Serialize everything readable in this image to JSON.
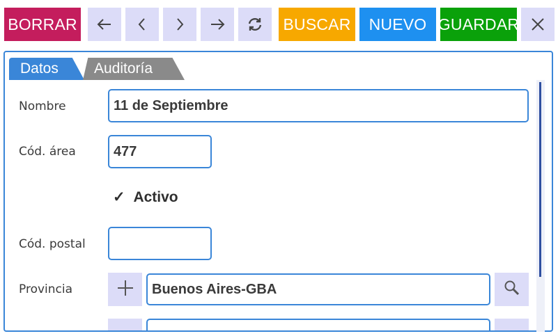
{
  "toolbar": {
    "borrar": "BORRAR",
    "buscar": "BUSCAR",
    "nuevo": "NUEVO",
    "guardar": "GUARDAR",
    "colors": {
      "borrar": "#c41d5d",
      "buscar": "#f7a800",
      "nuevo": "#1e90f0",
      "guardar": "#0aa10a",
      "nav": "#dcdcf8"
    },
    "icons": [
      "arrow-left-icon",
      "chevron-left-icon",
      "chevron-right-icon",
      "arrow-right-icon",
      "refresh-icon",
      "close-icon"
    ]
  },
  "tabs": [
    {
      "label": "Datos",
      "active": true
    },
    {
      "label": "Auditoría",
      "active": false
    }
  ],
  "form": {
    "nombre_label": "Nombre",
    "nombre_value": "11 de Septiembre",
    "cod_area_label": "Cód. área",
    "cod_area_value": "477",
    "activo_check": "✓",
    "activo_label": "Activo",
    "cod_postal_label": "Cód. postal",
    "cod_postal_value": "",
    "provincia_label": "Provincia",
    "provincia_value": "Buenos Aires-GBA"
  }
}
